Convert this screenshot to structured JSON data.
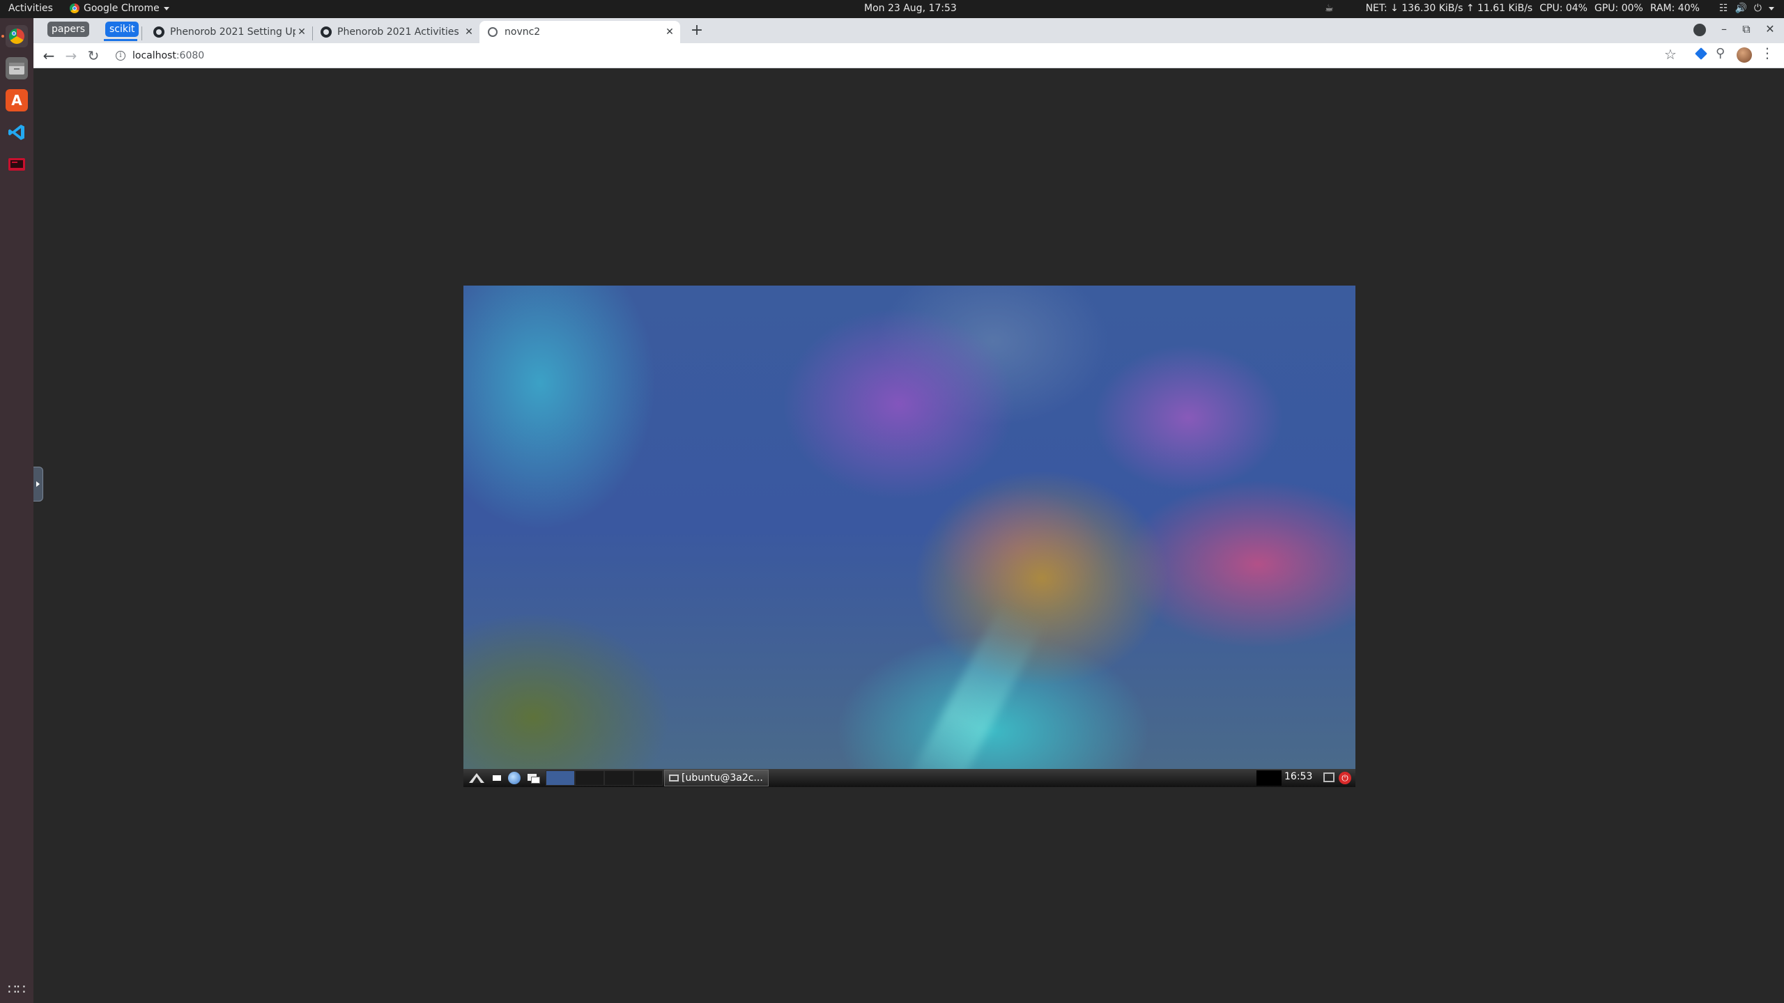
{
  "topbar": {
    "activities": "Activities",
    "app_name": "Google Chrome",
    "clock": "Mon 23 Aug, 17:53",
    "net": "NET: ↓ 136.30 KiB/s ↑ 11.61 KiB/s",
    "cpu": "CPU: 04%",
    "gpu": "GPU: 00%",
    "ram": "RAM: 40%",
    "tray_icons": [
      "coffee-icon",
      "network-icon",
      "volume-icon",
      "power-icon",
      "menu-arrow-icon"
    ]
  },
  "dock": {
    "items": [
      "chrome",
      "files",
      "ubuntu-software",
      "vscode",
      "terminal"
    ],
    "show_apps_icon": "grid-icon"
  },
  "browser": {
    "tab_groups": [
      {
        "label": "papers",
        "color": "#5f6368"
      },
      {
        "label": "scikit",
        "color": "#1a73e8"
      }
    ],
    "tabs": [
      {
        "title": "Phenorob 2021 Setting Up",
        "icon": "github-icon",
        "active": false
      },
      {
        "title": "Phenorob 2021 Activities",
        "icon": "github-icon",
        "active": false
      },
      {
        "title": "novnc2",
        "icon": "globe-icon",
        "active": true
      }
    ],
    "new_tab": "+",
    "url_host": "localhost",
    "url_port": ":6080"
  },
  "remote": {
    "task_label": "[ubuntu@3a2c...",
    "clock": "16:53"
  }
}
